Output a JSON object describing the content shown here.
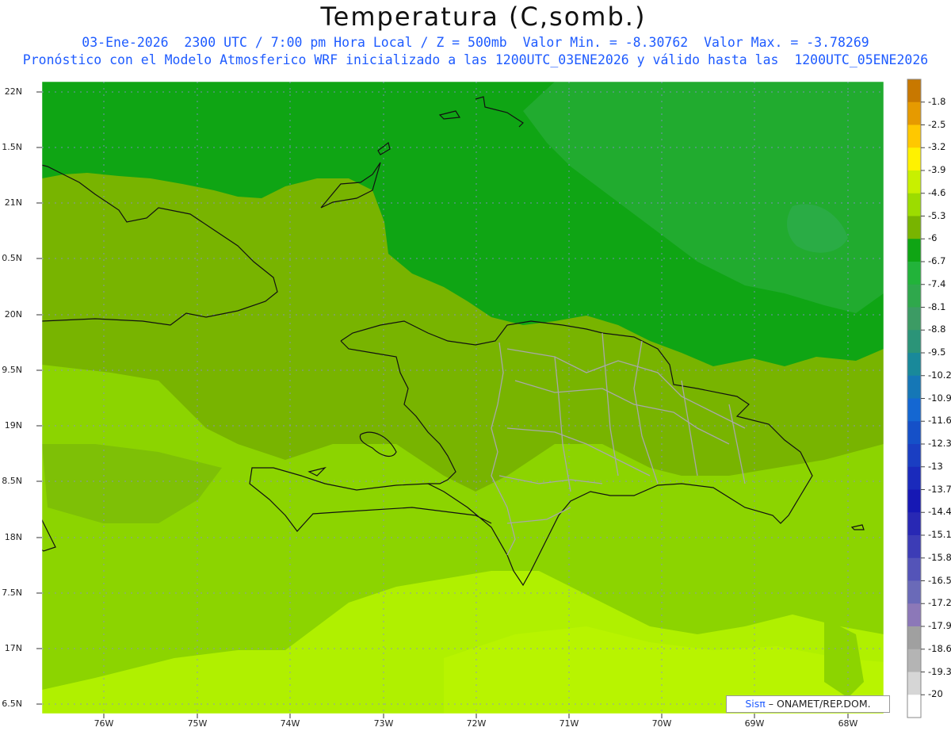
{
  "header": {
    "title": "Temperatura (C,somb.)",
    "subtitle1": "03-Ene-2026  2300 UTC / 7:00 pm Hora Local / Z = 500mb  Valor Min. = -8.30762  Valor Max. = -3.78269",
    "subtitle2": "Pronóstico con el Modelo Atmosferico WRF inicializado a las 1200UTC_03ENE2026 y válido hasta las  1200UTC_05ENE2026"
  },
  "axes": {
    "lat_labels": [
      "22N",
      "1.5N",
      "21N",
      "0.5N",
      "20N",
      "9.5N",
      "19N",
      "8.5N",
      "18N",
      "7.5N",
      "17N",
      "6.5N"
    ],
    "lon_labels": [
      "76W",
      "75W",
      "74W",
      "73W",
      "72W",
      "71W",
      "70W",
      "69W",
      "68W"
    ]
  },
  "colorbar": {
    "labels": [
      "-1.8",
      "-2.5",
      "-3.2",
      "-3.9",
      "-4.6",
      "-5.3",
      "-6",
      "-6.7",
      "-7.4",
      "-8.1",
      "-8.8",
      "-9.5",
      "-10.2",
      "-10.9",
      "-11.6",
      "-12.3",
      "-13",
      "-13.7",
      "-14.4",
      "-15.1",
      "-15.8",
      "-16.5",
      "-17.2",
      "-17.9",
      "-18.6",
      "-19.3",
      "-20"
    ],
    "colors": [
      "#c87800",
      "#e69a00",
      "#ffc800",
      "#fff200",
      "#c8f000",
      "#9cdc00",
      "#78b400",
      "#0fa514",
      "#22b33a",
      "#2fa84c",
      "#3c9b64",
      "#2b9478",
      "#19899a",
      "#1577b6",
      "#1467d2",
      "#1550c8",
      "#1a3ec2",
      "#1a2abc",
      "#1618b4",
      "#2828b4",
      "#3c3cb6",
      "#5454b8",
      "#6a6ab8",
      "#8c78b8",
      "#a0a0a0",
      "#b4b4b4",
      "#d6d6d6",
      "#ffffff"
    ]
  },
  "credit": {
    "brand": "Sisπ",
    "text": " – ONAMET/REP.DOM."
  }
}
